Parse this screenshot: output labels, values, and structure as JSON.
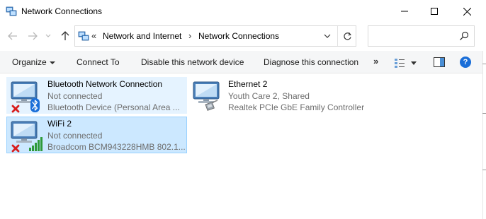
{
  "window": {
    "title": "Network Connections",
    "icon": "network-connections-icon"
  },
  "address": {
    "overflow": "«",
    "crumbs": [
      "Network and Internet",
      "Network Connections"
    ],
    "separator": "›"
  },
  "search": {
    "value": "",
    "placeholder": ""
  },
  "toolbar": {
    "organize": "Organize",
    "connect_to": "Connect To",
    "disable_device": "Disable this network device",
    "diagnose": "Diagnose this connection",
    "more": "»",
    "help": "?"
  },
  "connections": [
    {
      "name": "Bluetooth Network Connection",
      "status": "Not connected",
      "device": "Bluetooth Device (Personal Area ...",
      "icon": "bluetooth-network-icon",
      "state": "disconnected"
    },
    {
      "name": "Ethernet 2",
      "status": "Youth Care 2, Shared",
      "device": "Realtek PCIe GbE Family Controller",
      "icon": "ethernet-network-icon",
      "state": "connected"
    },
    {
      "name": "WiFi 2",
      "status": "Not connected",
      "device": "Broadcom BCM943228HMB 802.1...",
      "icon": "wifi-network-icon",
      "state": "disconnected"
    }
  ],
  "colors": {
    "selection_bg": "#cce8ff",
    "selection_border": "#99d1ff",
    "hover_bg": "#e5f3ff",
    "status_text": "#6d6d6d",
    "help_blue": "#1a6ed8",
    "error_red": "#d81e1e",
    "bluetooth_blue": "#1b6fd8",
    "signal_green": "#2e9a3a"
  }
}
